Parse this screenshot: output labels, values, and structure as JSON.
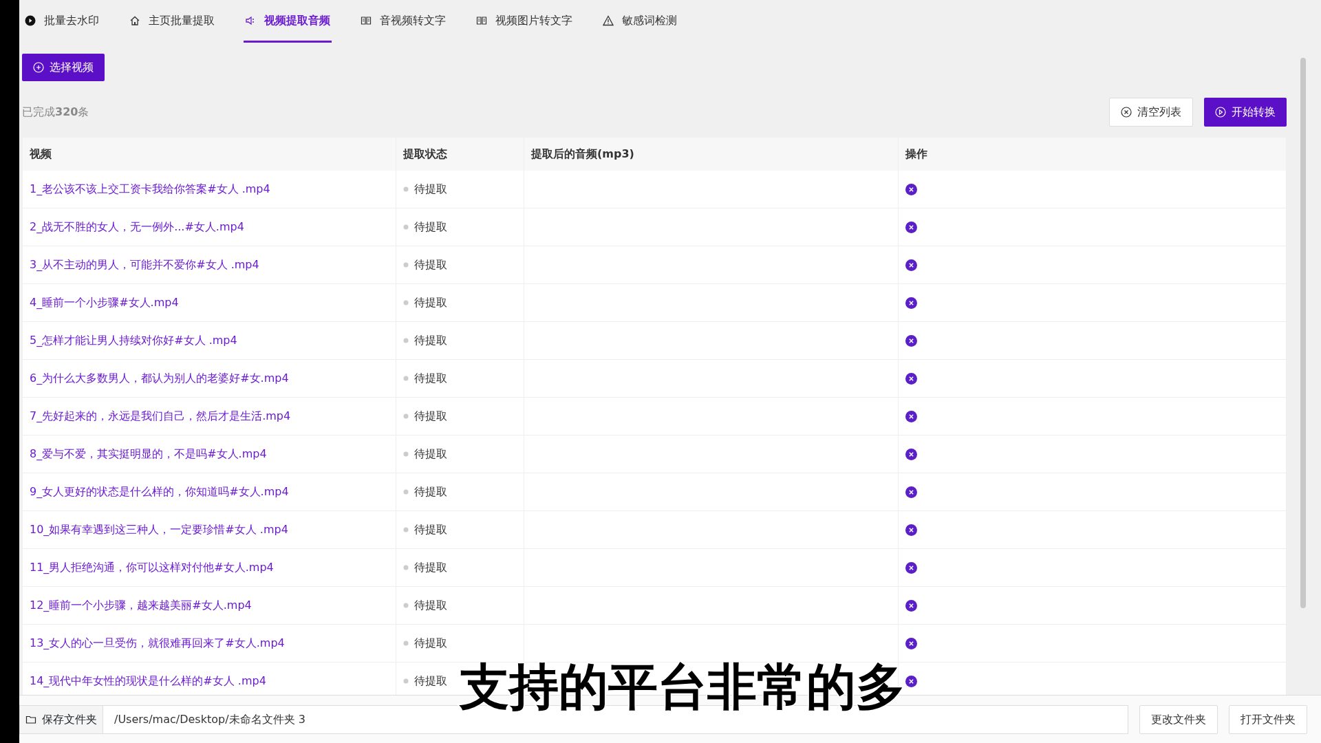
{
  "tabs": [
    {
      "label": "批量去水印",
      "selected": false
    },
    {
      "label": "主页批量提取",
      "selected": false
    },
    {
      "label": "视频提取音频",
      "selected": true
    },
    {
      "label": "音视频转文字",
      "selected": false
    },
    {
      "label": "视频图片转文字",
      "selected": false
    },
    {
      "label": "敏感词检测",
      "selected": false
    }
  ],
  "select_button": "选择视频",
  "summary": "已完成**320**条",
  "clear_button": "清空列表",
  "start_button": "开始转换",
  "table": {
    "columns": [
      "视频",
      "提取状态",
      "提取后的音频(mp3)",
      "操作"
    ],
    "rows": [
      {
        "video": "1_老公该不该上交工资卡我给你答案#女人 .mp4",
        "status": "待提取"
      },
      {
        "video": "2_战无不胜的女人，无一例外...#女人.mp4",
        "status": "待提取"
      },
      {
        "video": "3_从不主动的男人，可能并不爱你#女人 .mp4",
        "status": "待提取"
      },
      {
        "video": "4_睡前一个小步骤#女人.mp4",
        "status": "待提取"
      },
      {
        "video": "5_怎样才能让男人持续对你好#女人 .mp4",
        "status": "待提取"
      },
      {
        "video": "6_为什么大多数男人，都认为别人的老婆好#女.mp4",
        "status": "待提取"
      },
      {
        "video": "7_先好起来的，永远是我们自己，然后才是生活.mp4",
        "status": "待提取"
      },
      {
        "video": "8_爱与不爱，其实挺明显的，不是吗#女人.mp4",
        "status": "待提取"
      },
      {
        "video": "9_女人更好的状态是什么样的，你知道吗#女人.mp4",
        "status": "待提取"
      },
      {
        "video": "10_如果有幸遇到这三种人，一定要珍惜#女人 .mp4",
        "status": "待提取"
      },
      {
        "video": "11_男人拒绝沟通，你可以这样对付他#女人.mp4",
        "status": "待提取"
      },
      {
        "video": "12_睡前一个小步骤，越来越美丽#女人.mp4",
        "status": "待提取"
      },
      {
        "video": "13_女人的心一旦受伤，就很难再回来了#女人.mp4",
        "status": "待提取"
      },
      {
        "video": "14_现代中年女性的现状是什么样的#女人 .mp4",
        "status": "待提取"
      }
    ]
  },
  "footer": {
    "save_label": "保存文件夹",
    "path": "/Users/mac/Desktop/未命名文件夹 3",
    "change_button": "更改文件夹",
    "open_button": "打开文件夹"
  },
  "caption": "支持的平台非常的多"
}
